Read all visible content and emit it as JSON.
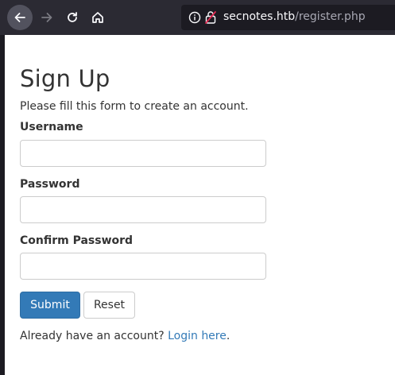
{
  "browser": {
    "url_host": "secnotes.htb",
    "url_path": "/register.php"
  },
  "form": {
    "title": "Sign Up",
    "subtitle": "Please fill this form to create an account.",
    "username_label": "Username",
    "username_value": "",
    "password_label": "Password",
    "password_value": "",
    "confirm_label": "Confirm Password",
    "confirm_value": "",
    "submit_label": "Submit",
    "reset_label": "Reset"
  },
  "footer": {
    "prefix": "Already have an account? ",
    "link_text": "Login here",
    "suffix": "."
  },
  "colors": {
    "primary": "#337ab7",
    "toolbar": "#2b2a33"
  }
}
